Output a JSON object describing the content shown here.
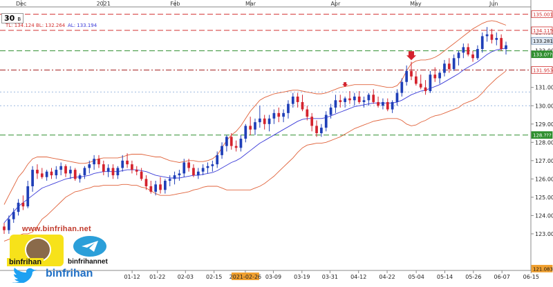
{
  "symbol": {
    "name": "30",
    "timeframe": "B"
  },
  "indicator_label": {
    "tl": "TL: 134.124",
    "bl": "BL: 132.264",
    "al": "AL: 133.194"
  },
  "price_tags": {
    "current": "133.281",
    "resistance_top": "135.001",
    "upper_band": "134.115",
    "green_level": "133.0??",
    "red_level": "131.953",
    "support": "128.???",
    "bottom": "121.083"
  },
  "watermark": {
    "site": "www.binfrihan.net",
    "snapchat_name": "binfrihan",
    "telegram_name": "binfrihannet",
    "twitter_name": "binfrihan"
  },
  "colors": {
    "bull": "#1f3fb8",
    "bear": "#d4232e",
    "ma": "#3a3ad8",
    "bands": "#e0623a",
    "red_line": "#d33030",
    "green_line": "#2f8f2f",
    "blue_line": "#9bb8e0"
  },
  "chart_data": {
    "type": "candlestick",
    "yaxis": {
      "range": [
        121.0,
        135.4
      ],
      "ticks": [
        "123.00",
        "124.00",
        "125.00",
        "126.00",
        "127.00",
        "128.00",
        "129.00",
        "130.00",
        "131.00",
        "132.00",
        "133.00",
        "134.00"
      ]
    },
    "xaxis": {
      "top_months": [
        {
          "label": "Dec",
          "pos": 0.04
        },
        {
          "label": "2021",
          "pos": 0.195
        },
        {
          "label": "Feb",
          "pos": 0.33
        },
        {
          "label": "Mar",
          "pos": 0.472
        },
        {
          "label": "Apr",
          "pos": 0.632
        },
        {
          "label": "May",
          "pos": 0.783
        },
        {
          "label": "Jun",
          "pos": 0.93
        }
      ],
      "bottom_dates": [
        {
          "label": "01-12",
          "pos": 0.245
        },
        {
          "label": "01-22",
          "pos": 0.292
        },
        {
          "label": "02-03",
          "pos": 0.344
        },
        {
          "label": "02-15",
          "pos": 0.397
        },
        {
          "label": "2021-02-26",
          "pos": 0.455,
          "highlight": true
        },
        {
          "label": "03-09",
          "pos": 0.507
        },
        {
          "label": "03-19",
          "pos": 0.56
        },
        {
          "label": "03-31",
          "pos": 0.612
        },
        {
          "label": "04-12",
          "pos": 0.665
        },
        {
          "label": "04-22",
          "pos": 0.718
        },
        {
          "label": "05-04",
          "pos": 0.772
        },
        {
          "label": "05-14",
          "pos": 0.825
        },
        {
          "label": "05-26",
          "pos": 0.878
        },
        {
          "label": "06-07",
          "pos": 0.931
        },
        {
          "label": "06-15",
          "pos": 0.985
        }
      ]
    },
    "hlines": [
      {
        "price": 135.0,
        "color": "red",
        "style": "dash"
      },
      {
        "price": 134.12,
        "color": "red",
        "style": "dash"
      },
      {
        "price": 133.0,
        "color": "green",
        "style": "dash"
      },
      {
        "price": 131.95,
        "color": "darkred",
        "style": "dashdot"
      },
      {
        "price": 130.75,
        "color": "blue",
        "style": "dot"
      },
      {
        "price": 130.0,
        "color": "blue",
        "style": "dot"
      },
      {
        "price": 128.4,
        "color": "green",
        "style": "dash"
      }
    ],
    "candles": [
      [
        123.4,
        123.6,
        123.0,
        123.2
      ],
      [
        123.2,
        124.0,
        123.0,
        123.8
      ],
      [
        123.8,
        124.4,
        123.6,
        124.2
      ],
      [
        124.2,
        124.9,
        124.0,
        124.7
      ],
      [
        124.7,
        125.1,
        124.3,
        124.5
      ],
      [
        124.5,
        125.9,
        124.4,
        125.6
      ],
      [
        125.6,
        126.7,
        125.3,
        126.5
      ],
      [
        126.5,
        126.8,
        126.0,
        126.3
      ],
      [
        126.3,
        126.6,
        126.0,
        126.1
      ],
      [
        126.1,
        126.5,
        125.9,
        126.4
      ],
      [
        126.4,
        126.6,
        126.0,
        126.2
      ],
      [
        126.2,
        126.7,
        126.0,
        126.5
      ],
      [
        126.5,
        126.9,
        126.2,
        126.7
      ],
      [
        126.7,
        126.8,
        126.1,
        126.3
      ],
      [
        126.3,
        126.7,
        126.0,
        126.5
      ],
      [
        126.5,
        126.6,
        125.9,
        126.0
      ],
      [
        126.0,
        126.3,
        125.8,
        126.2
      ],
      [
        126.2,
        126.7,
        126.0,
        126.6
      ],
      [
        126.6,
        127.0,
        126.3,
        126.8
      ],
      [
        126.8,
        127.3,
        126.5,
        127.1
      ],
      [
        127.1,
        127.3,
        126.6,
        126.8
      ],
      [
        126.8,
        127.0,
        126.2,
        126.4
      ],
      [
        126.4,
        126.8,
        126.1,
        126.6
      ],
      [
        126.6,
        126.8,
        126.0,
        126.2
      ],
      [
        126.2,
        126.7,
        126.0,
        126.6
      ],
      [
        126.6,
        127.3,
        126.4,
        127.0
      ],
      [
        127.0,
        127.4,
        126.6,
        126.8
      ],
      [
        126.8,
        127.0,
        126.3,
        126.5
      ],
      [
        126.5,
        126.7,
        126.2,
        126.4
      ],
      [
        126.4,
        126.6,
        125.9,
        126.0
      ],
      [
        126.0,
        126.2,
        125.4,
        125.6
      ],
      [
        125.6,
        125.9,
        125.2,
        125.3
      ],
      [
        125.3,
        125.9,
        125.1,
        125.7
      ],
      [
        125.7,
        126.1,
        125.2,
        125.4
      ],
      [
        125.4,
        126.0,
        125.2,
        125.9
      ],
      [
        125.9,
        126.2,
        125.6,
        126.0
      ],
      [
        126.0,
        126.4,
        125.7,
        126.2
      ],
      [
        126.2,
        126.5,
        125.9,
        126.3
      ],
      [
        126.3,
        127.1,
        126.1,
        126.9
      ],
      [
        126.9,
        127.1,
        126.4,
        126.6
      ],
      [
        126.6,
        126.8,
        126.1,
        126.2
      ],
      [
        126.2,
        126.6,
        126.0,
        126.4
      ],
      [
        126.4,
        126.8,
        126.2,
        126.6
      ],
      [
        126.6,
        126.9,
        126.3,
        126.7
      ],
      [
        126.7,
        127.0,
        126.4,
        126.8
      ],
      [
        126.8,
        127.5,
        126.6,
        127.3
      ],
      [
        127.3,
        128.0,
        127.1,
        127.8
      ],
      [
        127.8,
        128.4,
        127.5,
        128.3
      ],
      [
        128.3,
        128.5,
        127.6,
        127.8
      ],
      [
        127.8,
        128.1,
        127.5,
        127.7
      ],
      [
        127.7,
        128.4,
        127.5,
        128.2
      ],
      [
        128.2,
        129.0,
        128.0,
        128.9
      ],
      [
        128.9,
        129.4,
        128.4,
        128.7
      ],
      [
        128.7,
        129.3,
        128.4,
        129.1
      ],
      [
        129.1,
        130.0,
        128.8,
        129.3
      ],
      [
        129.3,
        129.5,
        128.7,
        129.0
      ],
      [
        129.0,
        129.5,
        128.6,
        129.3
      ],
      [
        129.3,
        129.8,
        129.0,
        129.6
      ],
      [
        129.6,
        129.9,
        129.1,
        129.4
      ],
      [
        129.4,
        129.8,
        129.1,
        129.6
      ],
      [
        129.6,
        130.3,
        129.3,
        130.1
      ],
      [
        130.1,
        130.7,
        129.9,
        130.5
      ],
      [
        130.5,
        130.7,
        129.9,
        130.2
      ],
      [
        130.2,
        130.6,
        129.7,
        129.8
      ],
      [
        129.8,
        130.0,
        129.2,
        129.4
      ],
      [
        129.4,
        129.6,
        128.6,
        128.9
      ],
      [
        128.9,
        129.2,
        128.3,
        128.5
      ],
      [
        128.5,
        129.0,
        128.3,
        128.8
      ],
      [
        128.8,
        129.7,
        128.6,
        129.5
      ],
      [
        129.5,
        130.1,
        129.3,
        129.9
      ],
      [
        129.9,
        130.6,
        129.6,
        130.3
      ],
      [
        130.3,
        130.6,
        129.9,
        130.2
      ],
      [
        130.2,
        130.5,
        129.9,
        130.4
      ],
      [
        130.4,
        130.8,
        130.1,
        130.3
      ],
      [
        130.3,
        130.7,
        130.0,
        130.5
      ],
      [
        130.5,
        130.8,
        130.1,
        130.2
      ],
      [
        130.2,
        130.5,
        129.9,
        130.3
      ],
      [
        130.3,
        130.7,
        130.0,
        130.6
      ],
      [
        130.6,
        130.9,
        130.1,
        130.2
      ],
      [
        130.2,
        130.5,
        129.9,
        130.0
      ],
      [
        130.0,
        130.4,
        129.8,
        130.2
      ],
      [
        130.2,
        130.4,
        129.7,
        129.8
      ],
      [
        129.8,
        130.3,
        129.6,
        130.2
      ],
      [
        130.2,
        130.9,
        130.0,
        130.7
      ],
      [
        130.7,
        131.5,
        130.5,
        131.3
      ],
      [
        131.3,
        132.2,
        131.1,
        131.9
      ],
      [
        131.9,
        132.4,
        131.4,
        131.6
      ],
      [
        131.6,
        131.9,
        131.1,
        131.2
      ],
      [
        131.2,
        131.7,
        130.9,
        131.0
      ],
      [
        131.0,
        131.4,
        130.6,
        130.8
      ],
      [
        130.8,
        131.9,
        130.7,
        131.7
      ],
      [
        131.7,
        132.1,
        131.3,
        131.5
      ],
      [
        131.5,
        131.9,
        131.2,
        131.8
      ],
      [
        131.8,
        132.5,
        131.6,
        132.3
      ],
      [
        132.3,
        132.6,
        131.8,
        132.0
      ],
      [
        132.0,
        132.8,
        131.9,
        132.6
      ],
      [
        132.6,
        133.0,
        132.2,
        132.9
      ],
      [
        132.9,
        133.4,
        132.6,
        133.2
      ],
      [
        133.2,
        133.4,
        132.7,
        132.8
      ],
      [
        132.8,
        133.0,
        132.4,
        132.6
      ],
      [
        132.6,
        133.3,
        132.5,
        133.1
      ],
      [
        133.1,
        134.0,
        132.9,
        133.8
      ],
      [
        133.8,
        134.3,
        133.5,
        133.9
      ],
      [
        133.9,
        134.2,
        133.4,
        133.6
      ],
      [
        133.6,
        134.0,
        133.3,
        133.7
      ],
      [
        133.7,
        133.9,
        133.0,
        133.1
      ],
      [
        133.1,
        133.5,
        132.8,
        133.3
      ]
    ],
    "ma": [
      123.6,
      123.9,
      124.2,
      124.5,
      124.7,
      124.9,
      125.1,
      125.3,
      125.5,
      125.6,
      125.7,
      125.8,
      125.9,
      126.0,
      126.05,
      126.1,
      126.1,
      126.15,
      126.2,
      126.3,
      126.35,
      126.4,
      126.4,
      126.4,
      126.4,
      126.45,
      126.5,
      126.5,
      126.5,
      126.45,
      126.4,
      126.3,
      126.2,
      126.15,
      126.1,
      126.05,
      126.05,
      126.05,
      126.1,
      126.15,
      126.2,
      126.2,
      126.25,
      126.3,
      126.35,
      126.45,
      126.6,
      126.75,
      126.9,
      127.0,
      127.15,
      127.35,
      127.55,
      127.75,
      127.95,
      128.1,
      128.25,
      128.4,
      128.55,
      128.7,
      128.85,
      129.0,
      129.15,
      129.25,
      129.3,
      129.3,
      129.3,
      129.3,
      129.35,
      129.45,
      129.55,
      129.65,
      129.75,
      129.85,
      129.95,
      130.0,
      130.05,
      130.1,
      130.15,
      130.15,
      130.15,
      130.15,
      130.15,
      130.2,
      130.3,
      130.45,
      130.6,
      130.7,
      130.8,
      130.85,
      130.95,
      131.05,
      131.15,
      131.3,
      131.45,
      131.6,
      131.75,
      131.95,
      132.1,
      132.25,
      132.4,
      132.6,
      132.8,
      132.95,
      133.05,
      133.1,
      133.15
    ],
    "upper_band": [
      124.6,
      125.1,
      125.6,
      126.1,
      126.4,
      126.8,
      127.1,
      127.2,
      127.2,
      127.2,
      127.15,
      127.1,
      127.05,
      127.0,
      126.95,
      126.9,
      126.85,
      126.85,
      126.9,
      127.0,
      127.1,
      127.15,
      127.15,
      127.15,
      127.15,
      127.2,
      127.3,
      127.35,
      127.35,
      127.35,
      127.3,
      127.25,
      127.2,
      127.2,
      127.1,
      127.0,
      126.95,
      126.9,
      126.95,
      127.0,
      127.0,
      126.95,
      126.95,
      127.0,
      127.1,
      127.3,
      127.7,
      128.1,
      128.4,
      128.6,
      128.9,
      129.3,
      129.7,
      130.0,
      130.3,
      130.45,
      130.55,
      130.65,
      130.7,
      130.75,
      130.8,
      130.85,
      130.85,
      130.8,
      130.75,
      130.7,
      130.65,
      130.65,
      130.7,
      130.8,
      130.9,
      131.0,
      131.05,
      131.1,
      131.15,
      131.15,
      131.15,
      131.15,
      131.15,
      131.1,
      131.05,
      131.0,
      131.0,
      131.1,
      131.4,
      131.9,
      132.3,
      132.45,
      132.5,
      132.5,
      132.55,
      132.65,
      132.8,
      133.0,
      133.2,
      133.4,
      133.6,
      133.8,
      134.0,
      134.2,
      134.35,
      134.5,
      134.6,
      134.65,
      134.6,
      134.5,
      134.4
    ],
    "lower_band": [
      122.6,
      122.7,
      122.8,
      122.9,
      123.0,
      123.0,
      123.1,
      123.4,
      123.8,
      124.0,
      124.25,
      124.5,
      124.75,
      125.0,
      125.15,
      125.3,
      125.35,
      125.45,
      125.5,
      125.6,
      125.6,
      125.65,
      125.65,
      125.65,
      125.65,
      125.7,
      125.7,
      125.65,
      125.65,
      125.55,
      125.5,
      125.35,
      125.2,
      125.1,
      125.1,
      125.1,
      125.15,
      125.2,
      125.25,
      125.3,
      125.4,
      125.45,
      125.55,
      125.6,
      125.6,
      125.6,
      125.5,
      125.4,
      125.4,
      125.4,
      125.4,
      125.4,
      125.4,
      125.5,
      125.6,
      125.75,
      125.95,
      126.15,
      126.4,
      126.65,
      126.9,
      127.15,
      127.45,
      127.7,
      127.85,
      127.9,
      127.95,
      127.95,
      128.0,
      128.1,
      128.2,
      128.3,
      128.45,
      128.6,
      128.75,
      128.85,
      128.95,
      129.05,
      129.15,
      129.2,
      129.25,
      129.3,
      129.3,
      129.3,
      129.2,
      129.0,
      128.9,
      128.95,
      129.1,
      129.2,
      129.35,
      129.45,
      129.5,
      129.6,
      129.7,
      129.8,
      129.9,
      130.1,
      130.2,
      130.3,
      130.45,
      130.7,
      131.0,
      131.25,
      131.5,
      131.7,
      131.9
    ]
  }
}
